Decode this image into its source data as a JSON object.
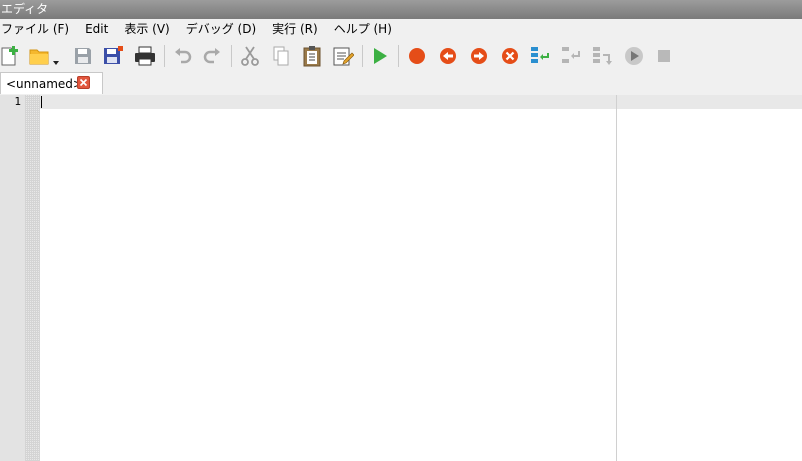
{
  "window": {
    "title": "エディタ"
  },
  "menu": [
    {
      "label": "ファイル (F)"
    },
    {
      "label": "Edit"
    },
    {
      "label": "表示 (V)"
    },
    {
      "label": "デバッグ (D)"
    },
    {
      "label": "実行 (R)"
    },
    {
      "label": "ヘルプ (H)"
    }
  ],
  "toolbar": {
    "icons": [
      "new-file-icon",
      "open-folder-icon",
      "save-icon",
      "save-all-icon",
      "print-icon",
      "undo-icon",
      "redo-icon",
      "cut-icon",
      "copy-icon",
      "paste-icon",
      "edit-icon",
      "run-icon",
      "breakpoint-icon",
      "step-back-icon",
      "step-forward-icon",
      "stop-debug-icon",
      "step-into-icon",
      "step-over-icon",
      "step-out-icon",
      "continue-icon",
      "stop-icon"
    ]
  },
  "tabs": [
    {
      "label": "<unnamed>"
    }
  ],
  "editor": {
    "line_numbers": [
      "1"
    ]
  },
  "colors": {
    "run": "#3cb043",
    "debug": "#e54d18",
    "titlebar": "#8a8a8a"
  }
}
